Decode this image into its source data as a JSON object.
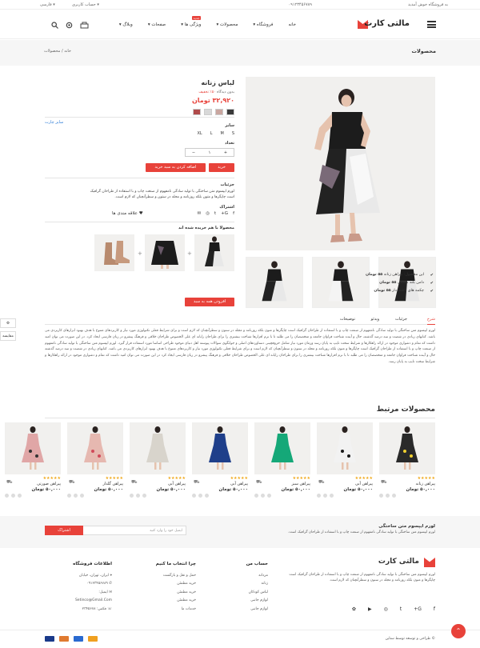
{
  "topbar": {
    "welcome": "به فروشگاه خوش آمدید",
    "phone": "۰۹۱۲۳۴۵۶۷۸۹",
    "language": "فارسی",
    "account": "حساب کاربری"
  },
  "header": {
    "logo": "مالتی کارت",
    "nav": [
      "خانه",
      "فروشگاه",
      "محصولات",
      "ویژگی ها",
      "صفحات",
      "وبلاگ"
    ],
    "new_badge": "جدید"
  },
  "breadcrumb": {
    "page_title": "محصولات",
    "home": "خانه",
    "separator": "/",
    "current": "محصولات"
  },
  "product": {
    "name": "لباس زنانه",
    "reviews": "بدون دیدگاه",
    "discount": "۵۰٪ تخفیف",
    "price": "۳۲,۹۲۰ تومان",
    "size_chart": "سایز چارت",
    "size_label": "سایز",
    "sizes": [
      "S",
      "M",
      "L",
      "XL"
    ],
    "quantity_label": "تعداد",
    "quantity": "۱",
    "add_to_cart": "اضافه کردن به سبد خرید",
    "buy_now": "خرید",
    "details_label": "جزئیات",
    "details_text": "لورم ایپسوم متن ساختگی با تولید سادگی نامفهوم از صنعت چاپ و با استفاده از طراحان گرافیک است چاپگرها و متون بلکه روزنامه و مجله در ستون و سطرآنچنان که لازم است.",
    "share_label": "اشتراک",
    "wishlist": "علاقه مندی ها",
    "swatch_colors": [
      "#3a3a3a",
      "#c9a6a0",
      "#d8d8d8",
      "#b04a4a"
    ]
  },
  "bought_together": {
    "title": "محصولا با هم خریده شده اند",
    "lines": [
      {
        "name": "این محصول: پیراهن زنانه",
        "price": "۵۵ تومان"
      },
      {
        "name": "دامن بلند مشکی",
        "price": "۵۵ تومان"
      },
      {
        "name": "چکمه های پاشنه دار",
        "price": "۵۵ تومان"
      }
    ],
    "button": "افزودن همه به سبد"
  },
  "side": {
    "settings": "⚙",
    "compare": "مقایسه"
  },
  "tabs": {
    "items": [
      "شرح",
      "جزئیات",
      "ویدئو",
      "توضیحات"
    ],
    "active": "شرح",
    "content": "لورم ایپسوم متن ساختگی با تولید سادگی نامفهوم از صنعت چاپ و با استفاده از طراحان گرافیک است چاپگرها و متون بلکه روزنامه و مجله در ستون و سطرآنچنان که لازم است و برای شرایط فعلی تکنولوژی مورد نیاز و کاربردهای متنوع با هدف بهبود ابزارهای کاربردی می باشد. کتابهای زیادی در شصت و سه درصد گذشته، حال و آینده شناخت فراوان جامعه و متخصصان را می طلبد تا با نرم افزارها شناخت بیشتری را برای طراحان رایانه ای علی الخصوص طراحان خلاقی و فرهنگ پیشرو در زبان فارسی ایجاد کرد. در این صورت می توان امید داشت که تمام و دشواری موجود در ارائه راهکارها و شرایط سخت تایپ به پایان رسد وزمان مورد نیاز شامل حروفچینی دستاوردهای اصلی و جوابگوی سوالات پیوسته اهل دنیای موجود طراحی اساسا مورد استفاده قرار گیرد. لورم ایپسوم متن ساختگی با تولید سادگی نامفهوم از صنعت چاپ و با استفاده از طراحان گرافیک است چاپگرها و متون بلکه روزنامه و مجله در ستون و سطرآنچنان که لازم است و برای شرایط فعلی تکنولوژی مورد نیاز و کاربردهای متنوع با هدف بهبود ابزارهای کاربردی می باشد. کتابهای زیادی در شصت و سه درصد گذشته حال و آینده شناخت فراوان جامعه و متخصصان را می طلبد تا با نرم افزارها شناخت بیشتری را برای طراحان رایانه ای علی الخصوص طراحان خلاقی و فرهنگ پیشرو در زبان فارسی ایجاد کرد در این صورت می توان امید داشت که تمام و دشواری موجود در ارائه راهکارها و شرایط سخت تایپ به پایان رسد."
  },
  "related": {
    "title": "محصولات مرتبط",
    "products": [
      {
        "name": "پیراهن زنانه",
        "price": "۵۰,۰۰۰ تومان",
        "stars": "★★★★★",
        "dress": "#2a2a2a",
        "accent": "#f0d030"
      },
      {
        "name": "پیراهن آبی",
        "price": "۵۰,۰۰۰ تومان",
        "stars": "★★★★★",
        "dress": "#f2f2f2",
        "accent": "#1a1a1a"
      },
      {
        "name": "پیراهن سبز",
        "price": "۵۰,۰۰۰ تومان",
        "stars": "★★★★★",
        "dress": "#15a878",
        "accent": "#15a878"
      },
      {
        "name": "پیراهن آبی",
        "price": "۵۰,۰۰۰ تومان",
        "stars": "★★★★★",
        "dress": "#1f3f8a",
        "accent": "#1f3f8a"
      },
      {
        "name": "پیراهن آبی",
        "price": "۵۰,۰۰۰ تومان",
        "stars": "★★★★★",
        "dress": "#d8d4cc",
        "accent": "#d8d4cc"
      },
      {
        "name": "پیراهن گلدار",
        "price": "۵۰,۰۰۰ تومان",
        "stars": "★★★★★",
        "dress": "#e6b8b0",
        "accent": "#d04a5a"
      },
      {
        "name": "پیراهن صورتی",
        "price": "۵۰,۰۰۰ تومان",
        "stars": "★★★★★",
        "dress": "#e0a6a6",
        "accent": "#333333"
      }
    ]
  },
  "newsletter": {
    "title": "لورم ایپسوم متن ساختگی",
    "text": "لورم ایپسوم متن ساختگی با تولید سادگی نامفهوم از صنعت چاپ و با استفاده از طراحان گرافیک است.",
    "placeholder": "ایمیل خود را وارد کنید",
    "button": "اشتراک"
  },
  "footer": {
    "logo": "مالتی کارت",
    "about": "لورم ایپسوم متن ساختگی با تولید سادگی نامفهوم از صنعت چاپ و با استفاده از طراحان گرافیک است چاپگرها و متون بلکه روزنامه و مجله در ستون و سطرآنچنان که لازم است.",
    "account_title": "حساب من",
    "account_links": [
      "مردانه",
      "زنانه",
      "لباس کودکان",
      "لوازم جانبی",
      "لوازم جانبی"
    ],
    "why_title": "چرا انتخاب ما کنیم",
    "why_links": [
      "حمل و نقل و بازگشت",
      "خرید مطمئن",
      "خرید مطمئن",
      "خرید مطمئن",
      "خدمات ما"
    ],
    "info_title": "اطلاعات فروشگاه",
    "info_lines": [
      "ایران، تهران، خیابان",
      "۰۹۱۲۳۴۵۶۷۸۹",
      "ایمیل:",
      "Setinco@Gmail.Com",
      "فکس: ۲۳۴۵۶۷۸"
    ],
    "copyright": "© طراحی و توسعه توسط ستاین",
    "social": [
      "f",
      "G+",
      "t",
      "◎",
      "▶",
      "✿"
    ]
  }
}
